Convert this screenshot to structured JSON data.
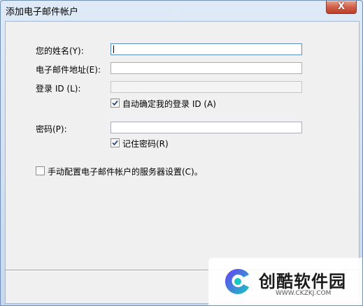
{
  "window": {
    "title": "添加电子邮件帐户",
    "close_glyph": "X"
  },
  "form": {
    "name_label": "您的姓名(Y):",
    "name_value": "",
    "email_label": "电子邮件地址(E):",
    "email_value": "",
    "login_id_label": "登录 ID (L):",
    "login_id_value": "",
    "auto_login_id_label": "自动确定我的登录 ID (A)",
    "auto_login_id_checked": true,
    "password_label": "密码(P):",
    "password_value": "",
    "remember_password_label": "记住密码(R)",
    "remember_password_checked": true,
    "manual_config_label": "手动配置电子邮件帐户的服务器设置(C)。",
    "manual_config_checked": false
  },
  "watermark": {
    "brand": "创酷软件园",
    "url": "WWW.CKZKJ.COM"
  },
  "colors": {
    "accent": "#3b6ea5",
    "logo_left": "#6a3df5",
    "logo_right": "#19c6c0"
  }
}
